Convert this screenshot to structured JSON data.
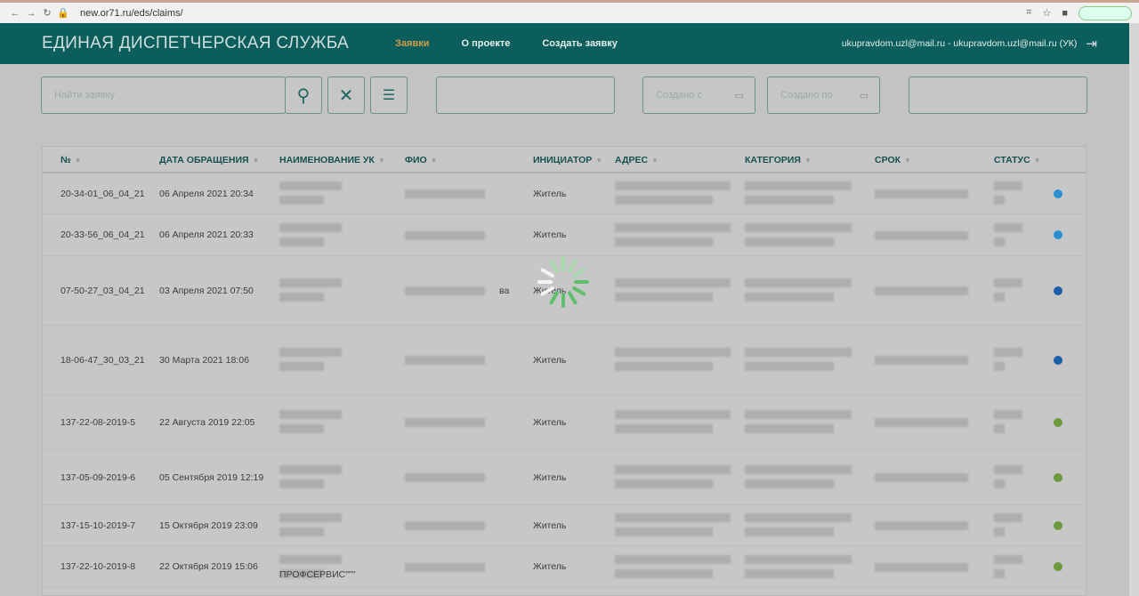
{
  "browser": {
    "url": "new.or71.ru/eds/claims/"
  },
  "header": {
    "title": "ЕДИНАЯ ДИСПЕТЧЕРСКАЯ СЛУЖБА",
    "nav": [
      "Заявки",
      "О проекте",
      "Создать заявку"
    ],
    "user": "ukupravdom.uzl@mail.ru - ukupravdom.uzl@mail.ru (УК)"
  },
  "filters": {
    "search_placeholder": "Найти заявку",
    "created_from": "Создано с",
    "created_to": "Создано по"
  },
  "table": {
    "columns": [
      "№",
      "ДАТА ОБРАЩЕНИЯ",
      "НАИМЕНОВАНИЕ УК",
      "ФИО",
      "ИНИЦИАТОР",
      "АДРЕС",
      "КАТЕГОРИЯ",
      "СРОК",
      "СТАТУС"
    ],
    "rows": [
      {
        "id": "20-34-01_06_04_21",
        "date": "06 Апреля 2021 20:34",
        "uk": "",
        "fio": "",
        "initiator": "Житель",
        "status_color": "#2b8fd2"
      },
      {
        "id": "20-33-56_06_04_21",
        "date": "06 Апреля 2021 20:33",
        "uk": "",
        "fio": "",
        "initiator": "Житель",
        "status_color": "#2b8fd2"
      },
      {
        "id": "07-50-27_03_04_21",
        "date": "03 Апреля 2021 07:50",
        "uk": "",
        "fio": "ва",
        "initiator": "Житель",
        "status_color": "#1d5ea8"
      },
      {
        "id": "18-06-47_30_03_21",
        "date": "30 Марта 2021 18:06",
        "uk": "",
        "fio": "",
        "initiator": "Житель",
        "status_color": "#1d5ea8"
      },
      {
        "id": "137-22-08-2019-5",
        "date": "22 Августа 2019 22:05",
        "uk": "",
        "fio": "",
        "initiator": "Житель",
        "status_color": "#6b9a3c"
      },
      {
        "id": "137-05-09-2019-6",
        "date": "05 Сентября 2019 12:19",
        "uk": "",
        "fio": "",
        "initiator": "Житель",
        "status_color": "#6b9a3c"
      },
      {
        "id": "137-15-10-2019-7",
        "date": "15 Октября 2019 23:09",
        "uk": "",
        "fio": "",
        "initiator": "Житель",
        "status_color": "#6b9a3c"
      },
      {
        "id": "137-22-10-2019-8",
        "date": "22 Октября 2019 15:06",
        "uk": "ПРОФСЕРВИС\"\"\"",
        "fio": "",
        "initiator": "Житель",
        "status_color": "#6b9a3c"
      }
    ]
  }
}
